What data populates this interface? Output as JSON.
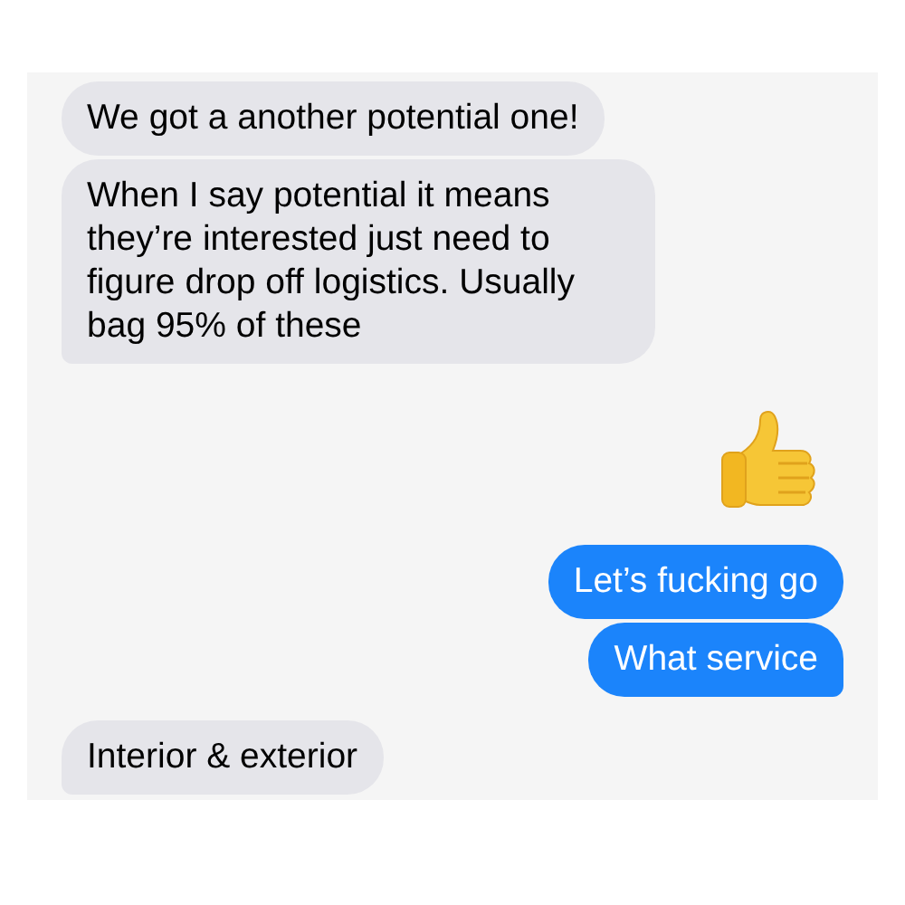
{
  "messages": [
    {
      "kind": "text",
      "outgoing": false,
      "text": "We got a another potential one!",
      "tail": false
    },
    {
      "kind": "text",
      "outgoing": false,
      "text": "When I say potential it means they’re interested just need to figure drop off logistics. Usually bag 95% of these",
      "tail": true
    },
    {
      "kind": "thumbs-up",
      "outgoing": true
    },
    {
      "kind": "text",
      "outgoing": true,
      "text": "Let’s fucking go",
      "tail": false
    },
    {
      "kind": "text",
      "outgoing": true,
      "text": "What service",
      "tail": true
    },
    {
      "kind": "text",
      "outgoing": false,
      "text": "Interior & exterior",
      "tail": true
    }
  ]
}
